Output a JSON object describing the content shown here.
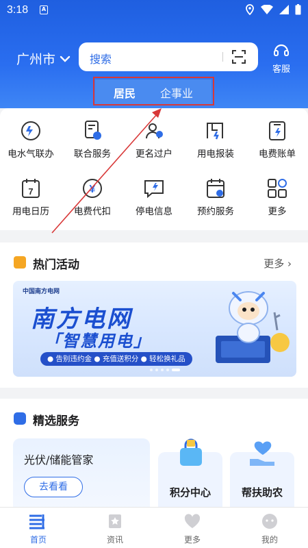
{
  "status_bar": {
    "time": "3:18",
    "notification_letter": "A"
  },
  "header": {
    "city": "广州市",
    "search_placeholder": "搜索",
    "service_label": "客服",
    "tabs": [
      {
        "label": "居民",
        "active": true
      },
      {
        "label": "企事业",
        "active": false
      }
    ]
  },
  "grid": [
    {
      "label": "电水气联办",
      "icon": "water-electric-gas-icon"
    },
    {
      "label": "联合服务",
      "icon": "joint-service-icon"
    },
    {
      "label": "更名过户",
      "icon": "rename-transfer-icon"
    },
    {
      "label": "用电报装",
      "icon": "power-install-icon"
    },
    {
      "label": "电费账单",
      "icon": "bill-icon"
    },
    {
      "label": "用电日历",
      "icon": "calendar-icon"
    },
    {
      "label": "电费代扣",
      "icon": "auto-debit-icon"
    },
    {
      "label": "停电信息",
      "icon": "outage-info-icon"
    },
    {
      "label": "预约服务",
      "icon": "appointment-icon"
    },
    {
      "label": "更多",
      "icon": "more-grid-icon"
    }
  ],
  "hot": {
    "title": "热门活动",
    "more": "更多",
    "banner": {
      "logo": "中国南方电网",
      "title": "南方电网",
      "subtitle": "「智慧用电」",
      "pill": "● 告别违约金 ● 充值送积分 ● 轻松换礼品"
    }
  },
  "featured": {
    "title": "精选服务",
    "big_card": {
      "title": "光伏/储能管家",
      "button": "去看看"
    },
    "cards": [
      {
        "label": "积分中心"
      },
      {
        "label": "帮扶助农"
      }
    ]
  },
  "nav": [
    {
      "label": "首页",
      "active": true
    },
    {
      "label": "资讯",
      "active": false
    },
    {
      "label": "更多",
      "active": false
    },
    {
      "label": "我的",
      "active": false
    }
  ],
  "colors": {
    "primary": "#2a6ef0",
    "annotation": "#d83838"
  }
}
